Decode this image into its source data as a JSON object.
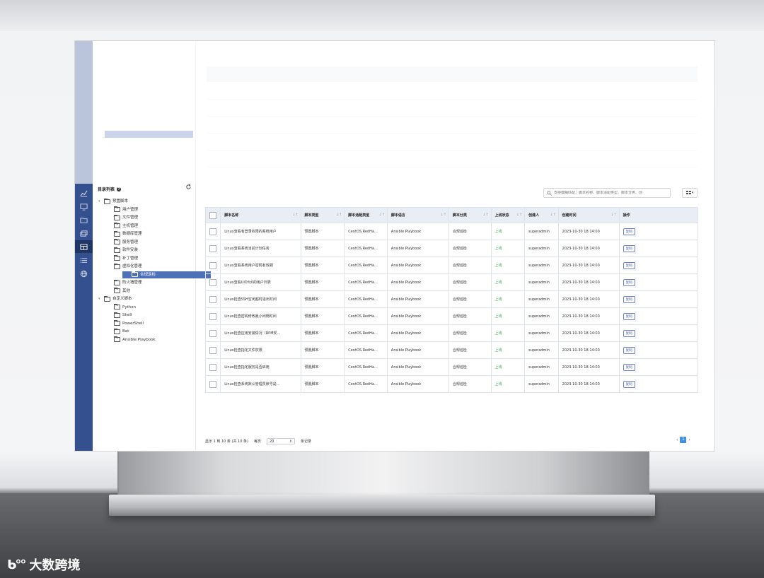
{
  "tree": {
    "title": "目录列表",
    "help": "?",
    "nodes": [
      {
        "label": "预置脚本",
        "level": 0,
        "expanded": true
      },
      {
        "label": "用户管理",
        "level": 1
      },
      {
        "label": "文件管理",
        "level": 1
      },
      {
        "label": "主机管理",
        "level": 1
      },
      {
        "label": "数据库管理",
        "level": 1
      },
      {
        "label": "服务管理",
        "level": 1
      },
      {
        "label": "软件安装",
        "level": 1
      },
      {
        "label": "补丁管理",
        "level": 1
      },
      {
        "label": "虚拟化管理",
        "level": 1
      },
      {
        "label": "合规巡检",
        "level": 1,
        "selected": true
      },
      {
        "label": "防火墙管理",
        "level": 1
      },
      {
        "label": "其他",
        "level": 1
      },
      {
        "label": "自定义脚本",
        "level": 0,
        "expanded": true
      },
      {
        "label": "Python",
        "level": 1
      },
      {
        "label": "Shell",
        "level": 1
      },
      {
        "label": "PowerShell",
        "level": 1
      },
      {
        "label": "Bat",
        "level": 1
      },
      {
        "label": "Ansible Playbook",
        "level": 1
      }
    ]
  },
  "search": {
    "placeholder": "支持模糊匹配：脚本名称、脚本适配类型、脚本分类、创"
  },
  "colbtn": {
    "label": "▾"
  },
  "table": {
    "headers": [
      "脚本名称",
      "脚本类型",
      "脚本适配类型",
      "脚本语言",
      "脚本分类",
      "上线状态",
      "创建人",
      "创建时间",
      "操作"
    ],
    "rows": [
      {
        "name": "Linux查看有登录权限的系统用户",
        "type": "预置脚本",
        "adapt": "CentOS,RedHa...",
        "lang": "Ansible Playbook",
        "category": "合规巡检",
        "status": "上线",
        "creator": "superadmin",
        "time": "2023-10-30 18:14:00",
        "action": "复制"
      },
      {
        "name": "Linux查看系统当前计划任务",
        "type": "预置脚本",
        "adapt": "CentOS,RedHa...",
        "lang": "Ansible Playbook",
        "category": "合规巡检",
        "status": "上线",
        "creator": "superadmin",
        "time": "2023-10-30 18:14:00",
        "action": "复制"
      },
      {
        "name": "Linux查看系统用户密码有效期",
        "type": "预置脚本",
        "adapt": "CentOS,RedHa...",
        "lang": "Ansible Playbook",
        "category": "合规巡检",
        "status": "上线",
        "creator": "superadmin",
        "time": "2023-10-30 18:14:00",
        "action": "复制"
      },
      {
        "name": "Linux查看UID为0的用户列表",
        "type": "预置脚本",
        "adapt": "CentOS,RedHa...",
        "lang": "Ansible Playbook",
        "category": "合规巡检",
        "status": "上线",
        "creator": "superadmin",
        "time": "2023-10-30 18:14:00",
        "action": "复制"
      },
      {
        "name": "Linux检查SSH空闲超时退出时间",
        "type": "预置脚本",
        "adapt": "CentOS,RedHa...",
        "lang": "Ansible Playbook",
        "category": "合规巡检",
        "status": "上线",
        "creator": "superadmin",
        "time": "2023-10-30 18:14:00",
        "action": "复制"
      },
      {
        "name": "Linux检查密码修改最小间隔时间",
        "type": "预置脚本",
        "adapt": "CentOS,RedHa...",
        "lang": "Ansible Playbook",
        "category": "合规巡检",
        "status": "上线",
        "creator": "superadmin",
        "time": "2023-10-30 18:14:00",
        "action": "复制"
      },
      {
        "name": "Linux检查应用安装情况（RPM安...",
        "type": "预置脚本",
        "adapt": "CentOS,RedHa...",
        "lang": "Ansible Playbook",
        "category": "合规巡检",
        "status": "上线",
        "creator": "superadmin",
        "time": "2023-10-30 18:14:00",
        "action": "复制"
      },
      {
        "name": "Linux检查指定文件权限",
        "type": "预置脚本",
        "adapt": "CentOS,RedHa...",
        "lang": "Ansible Playbook",
        "category": "合规巡检",
        "status": "上线",
        "creator": "superadmin",
        "time": "2023-10-30 18:14:00",
        "action": "复制"
      },
      {
        "name": "Linux检查指定服务是否启用",
        "type": "预置脚本",
        "adapt": "CentOS,RedHa...",
        "lang": "Ansible Playbook",
        "category": "合规巡检",
        "status": "上线",
        "creator": "superadmin",
        "time": "2023-10-30 18:14:00",
        "action": "复制"
      },
      {
        "name": "Linux检查系统默认管理员账号是...",
        "type": "预置脚本",
        "adapt": "CentOS,RedHa...",
        "lang": "Ansible Playbook",
        "category": "合规巡检",
        "status": "上线",
        "creator": "superadmin",
        "time": "2023-10-30 18:14:00",
        "action": "复制"
      }
    ]
  },
  "footer": {
    "summary": "显示 1 到 10 条 (共 10 条)",
    "per_page_label": "每页",
    "page_size": "20",
    "unit": "条记录"
  },
  "pager": {
    "prev": "‹",
    "current": "1",
    "next": "›"
  },
  "watermark": {
    "mark": "ᑲ°°",
    "text": "大数跨境"
  },
  "colors": {
    "nav": "#34508f",
    "nav_active": "#1f3566",
    "selected": "#4d70b8",
    "online": "#3aa34a",
    "page_active": "#3f8fe3"
  },
  "nav_icons": [
    "chart-icon",
    "monitor-icon",
    "folder-icon",
    "layers-icon",
    "script-box-icon",
    "list-icon",
    "globe-icon"
  ]
}
